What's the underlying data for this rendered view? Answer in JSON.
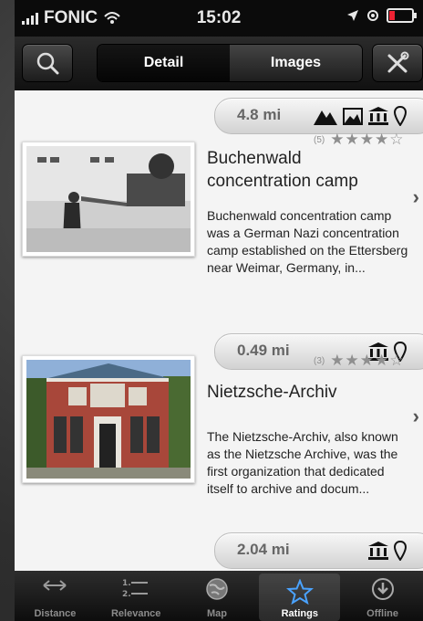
{
  "status_bar": {
    "carrier": "FONIC",
    "time": "15:02"
  },
  "toolbar": {
    "segments": [
      "Detail",
      "Images"
    ],
    "search_icon": "search-icon",
    "tools_icon": "tools-icon"
  },
  "items": [
    {
      "distance": "4.8 mi",
      "category_icons": [
        "mountain-icon",
        "landscape-icon",
        "museum-icon",
        "location-pin-icon"
      ]
    },
    {
      "rating_count": "(5)",
      "stars": "★★★★☆",
      "title": "Buchenwald concentration camp",
      "description": "Buchenwald concentration camp was a German Nazi concentration camp established on the Ettersberg near Weimar, Germany, in...",
      "distance": "0.49 mi",
      "category_icons": [
        "museum-icon",
        "location-pin-icon"
      ]
    },
    {
      "rating_count": "(3)",
      "stars": "★★★★☆",
      "title": "Nietzsche-Archiv",
      "description": "The Nietzsche-Archiv, also known as the Nietzsche Archive, was the first organization that dedicated itself to archive and docum...",
      "distance": "2.04 mi",
      "category_icons": [
        "museum-icon",
        "location-pin-icon"
      ]
    }
  ],
  "tab_bar": {
    "tabs": [
      {
        "label": "Distance",
        "icon": "distance-arrows-icon"
      },
      {
        "label": "Relevance",
        "icon": "numbered-list-icon"
      },
      {
        "label": "Map",
        "icon": "globe-icon"
      },
      {
        "label": "Ratings",
        "icon": "star-icon"
      },
      {
        "label": "Offline",
        "icon": "download-icon"
      }
    ],
    "selected": "Ratings"
  },
  "colors": {
    "accent_tab": "#ffffff",
    "star_color": "#8f8f8f"
  }
}
